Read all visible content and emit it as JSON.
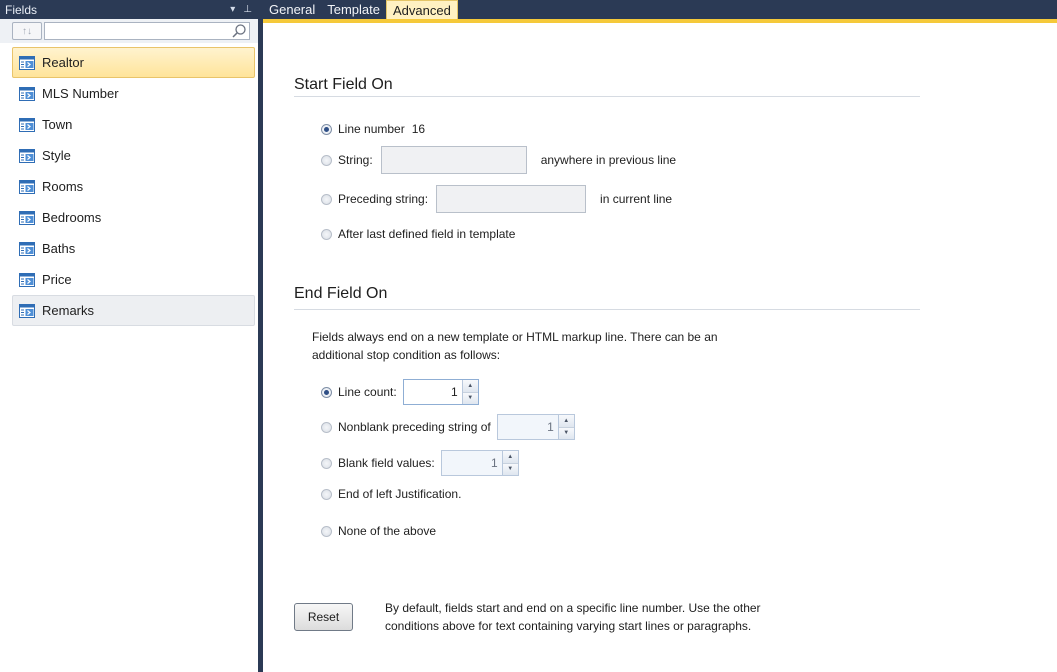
{
  "fields_panel": {
    "title": "Fields",
    "dropdown_glyph": "▾",
    "pin_glyph": "⊥",
    "sort_glyph": "↑↓",
    "search_placeholder": "",
    "items": [
      {
        "label": "Realtor",
        "state": "selected"
      },
      {
        "label": "MLS Number",
        "state": "normal"
      },
      {
        "label": "Town",
        "state": "normal"
      },
      {
        "label": "Style",
        "state": "normal"
      },
      {
        "label": "Rooms",
        "state": "normal"
      },
      {
        "label": "Bedrooms",
        "state": "normal"
      },
      {
        "label": "Baths",
        "state": "normal"
      },
      {
        "label": "Price",
        "state": "normal"
      },
      {
        "label": "Remarks",
        "state": "hover"
      }
    ]
  },
  "tabs": [
    {
      "label": "General",
      "active": false
    },
    {
      "label": "Template",
      "active": false
    },
    {
      "label": "Advanced",
      "active": true
    }
  ],
  "start_section": {
    "title": "Start Field On",
    "line_number_label": "Line number",
    "line_number_value": "16",
    "string_label": "String:",
    "string_value": "",
    "string_suffix": "anywhere in previous line",
    "preceding_label": "Preceding string:",
    "preceding_value": "",
    "preceding_suffix": "in current line",
    "after_last_label": "After last defined field in template",
    "selected": "line_number"
  },
  "end_section": {
    "title": "End Field On",
    "description_line1": "Fields always end on a new template or HTML markup line.  There can be an",
    "description_line2": "additional stop condition as follows:",
    "line_count_label": "Line count:",
    "line_count_value": "1",
    "nonblank_label": "Nonblank preceding string of",
    "nonblank_value": "1",
    "blank_label": "Blank field values:",
    "blank_value": "1",
    "end_left_label": "End of left Justification.",
    "none_label": "None of the above",
    "selected": "line_count"
  },
  "reset": {
    "label": "Reset",
    "note_line1": "By default, fields start and end on a specific line number.  Use the other",
    "note_line2": "conditions above for text containing varying start lines or paragraphs."
  },
  "colors": {
    "panel_dark": "#2b3a55",
    "active_tab": "#fff1c2",
    "tab_accent": "#f5c93a",
    "selected_item": "#ffe49a"
  }
}
